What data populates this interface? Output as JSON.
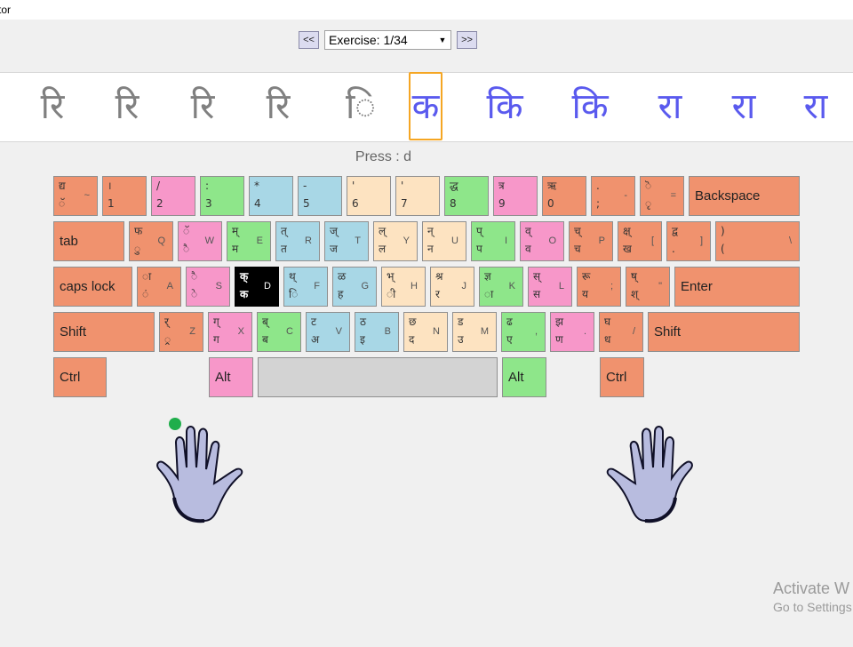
{
  "window": {
    "title_fragment": "tor"
  },
  "nav": {
    "prev_label": "<<",
    "next_label": ">>",
    "exercise_value": "Exercise: 1/34",
    "dropdown_arrow": "▼"
  },
  "strip": {
    "glyphs": [
      {
        "text": "रि",
        "state": "done"
      },
      {
        "text": "रि",
        "state": "done"
      },
      {
        "text": "रि",
        "state": "done"
      },
      {
        "text": "रि",
        "state": "done"
      },
      {
        "text": "ि",
        "state": "done"
      },
      {
        "text": "क",
        "state": "current"
      },
      {
        "text": "कि",
        "state": "todo"
      },
      {
        "text": "कि",
        "state": "todo"
      },
      {
        "text": "रा",
        "state": "todo"
      },
      {
        "text": "रा",
        "state": "todo"
      },
      {
        "text": "रा",
        "state": "todo"
      }
    ]
  },
  "press_prompt": "Press : d",
  "colors": {
    "salmon": "#f0926e",
    "pink": "#f797c9",
    "green": "#8ee68a",
    "blue": "#a8d7e6",
    "beige": "#fde3c1",
    "space": "#d3d3d3",
    "black": "#000000"
  },
  "keyboard": {
    "rows": [
      [
        {
          "tl": "द्य",
          "bl": "ॅ",
          "en": "~",
          "color": "salmon"
        },
        {
          "tl": "।",
          "bl": "1",
          "en": "",
          "color": "salmon"
        },
        {
          "tl": "/",
          "bl": "2",
          "en": "",
          "color": "pink"
        },
        {
          "tl": ":",
          "bl": "3",
          "en": "",
          "color": "green"
        },
        {
          "tl": "*",
          "bl": "4",
          "en": "",
          "color": "blue"
        },
        {
          "tl": "-",
          "bl": "5",
          "en": "",
          "color": "blue"
        },
        {
          "tl": "'",
          "bl": "6",
          "en": "",
          "color": "beige"
        },
        {
          "tl": "'",
          "bl": "7",
          "en": "",
          "color": "beige"
        },
        {
          "tl": "द्ध",
          "bl": "8",
          "en": "",
          "color": "green"
        },
        {
          "tl": "त्र",
          "bl": "9",
          "en": "",
          "color": "pink"
        },
        {
          "tl": "ऋ",
          "bl": "0",
          "en": "",
          "color": "salmon"
        },
        {
          "tl": ".",
          "bl": ";",
          "en": "-",
          "color": "salmon"
        },
        {
          "tl": "ॆ",
          "bl": "ृ",
          "en": "=",
          "color": "salmon"
        },
        {
          "label": "Backspace",
          "color": "salmon"
        }
      ],
      [
        {
          "label": "tab",
          "color": "salmon"
        },
        {
          "tl": "फ",
          "bl": "ु",
          "en": "Q",
          "color": "salmon"
        },
        {
          "tl": "ॅ",
          "bl": "ै",
          "en": "W",
          "color": "pink"
        },
        {
          "tl": "म्",
          "bl": "म",
          "en": "E",
          "color": "green"
        },
        {
          "tl": "त्",
          "bl": "त",
          "en": "R",
          "color": "blue"
        },
        {
          "tl": "ज्",
          "bl": "ज",
          "en": "T",
          "color": "blue"
        },
        {
          "tl": "ल्",
          "bl": "ल",
          "en": "Y",
          "color": "beige"
        },
        {
          "tl": "न्",
          "bl": "न",
          "en": "U",
          "color": "beige"
        },
        {
          "tl": "प्",
          "bl": "प",
          "en": "I",
          "color": "green"
        },
        {
          "tl": "व्",
          "bl": "व",
          "en": "O",
          "color": "pink"
        },
        {
          "tl": "च्",
          "bl": "च",
          "en": "P",
          "color": "salmon"
        },
        {
          "tl": "क्ष्",
          "bl": "ख",
          "en": "[",
          "color": "salmon"
        },
        {
          "tl": "द्व",
          "bl": ".",
          "en": "]",
          "color": "salmon"
        },
        {
          "tl": ")",
          "bl": "(",
          "en": "\\",
          "color": "salmon"
        }
      ],
      [
        {
          "label": "caps  lock",
          "color": "salmon"
        },
        {
          "tl": "ा",
          "bl": "ं",
          "en": "A",
          "color": "salmon"
        },
        {
          "tl": "ै",
          "bl": "े",
          "en": "S",
          "color": "pink"
        },
        {
          "tl": "क्",
          "bl": "क",
          "en": "D",
          "color": "black",
          "highlight": true
        },
        {
          "tl": "थ्",
          "bl": "ि",
          "en": "F",
          "color": "blue"
        },
        {
          "tl": "ळ",
          "bl": "ह",
          "en": "G",
          "color": "blue"
        },
        {
          "tl": "भ्",
          "bl": "ी",
          "en": "H",
          "color": "beige"
        },
        {
          "tl": "श्र",
          "bl": "र",
          "en": "J",
          "color": "beige"
        },
        {
          "tl": "ज्ञ",
          "bl": "ा",
          "en": "K",
          "color": "green"
        },
        {
          "tl": "स्",
          "bl": "स",
          "en": "L",
          "color": "pink"
        },
        {
          "tl": "रू",
          "bl": "य",
          "en": ";",
          "color": "salmon"
        },
        {
          "tl": "ष्",
          "bl": "श्",
          "en": "\"",
          "color": "salmon"
        },
        {
          "label": "Enter",
          "color": "salmon"
        }
      ],
      [
        {
          "label": "Shift",
          "color": "salmon"
        },
        {
          "tl": "र्",
          "bl": "्र",
          "en": "Z",
          "color": "salmon"
        },
        {
          "tl": "ग्",
          "bl": "ग",
          "en": "X",
          "color": "pink"
        },
        {
          "tl": "ब्",
          "bl": "ब",
          "en": "C",
          "color": "green"
        },
        {
          "tl": "ट",
          "bl": "अ",
          "en": "V",
          "color": "blue"
        },
        {
          "tl": "ठ",
          "bl": "इ",
          "en": "B",
          "color": "blue"
        },
        {
          "tl": "छ",
          "bl": "द",
          "en": "N",
          "color": "beige"
        },
        {
          "tl": "ड",
          "bl": "उ",
          "en": "M",
          "color": "beige"
        },
        {
          "tl": "ढ",
          "bl": "ए",
          "en": ",",
          "color": "green"
        },
        {
          "tl": "झ",
          "bl": "ण",
          "en": ".",
          "color": "pink"
        },
        {
          "tl": "घ",
          "bl": "ध",
          "en": "/",
          "color": "salmon"
        },
        {
          "label": "Shift",
          "color": "salmon"
        }
      ],
      [
        {
          "label": "Ctrl",
          "color": "salmon"
        },
        {
          "label": "Alt",
          "color": "pink"
        },
        {
          "label": "",
          "color": "space"
        },
        {
          "label": "Alt",
          "color": "green"
        },
        {
          "label": "Ctrl",
          "color": "salmon"
        }
      ]
    ]
  },
  "watermark": {
    "line1": "Activate W",
    "line2": "Go to Settings"
  }
}
